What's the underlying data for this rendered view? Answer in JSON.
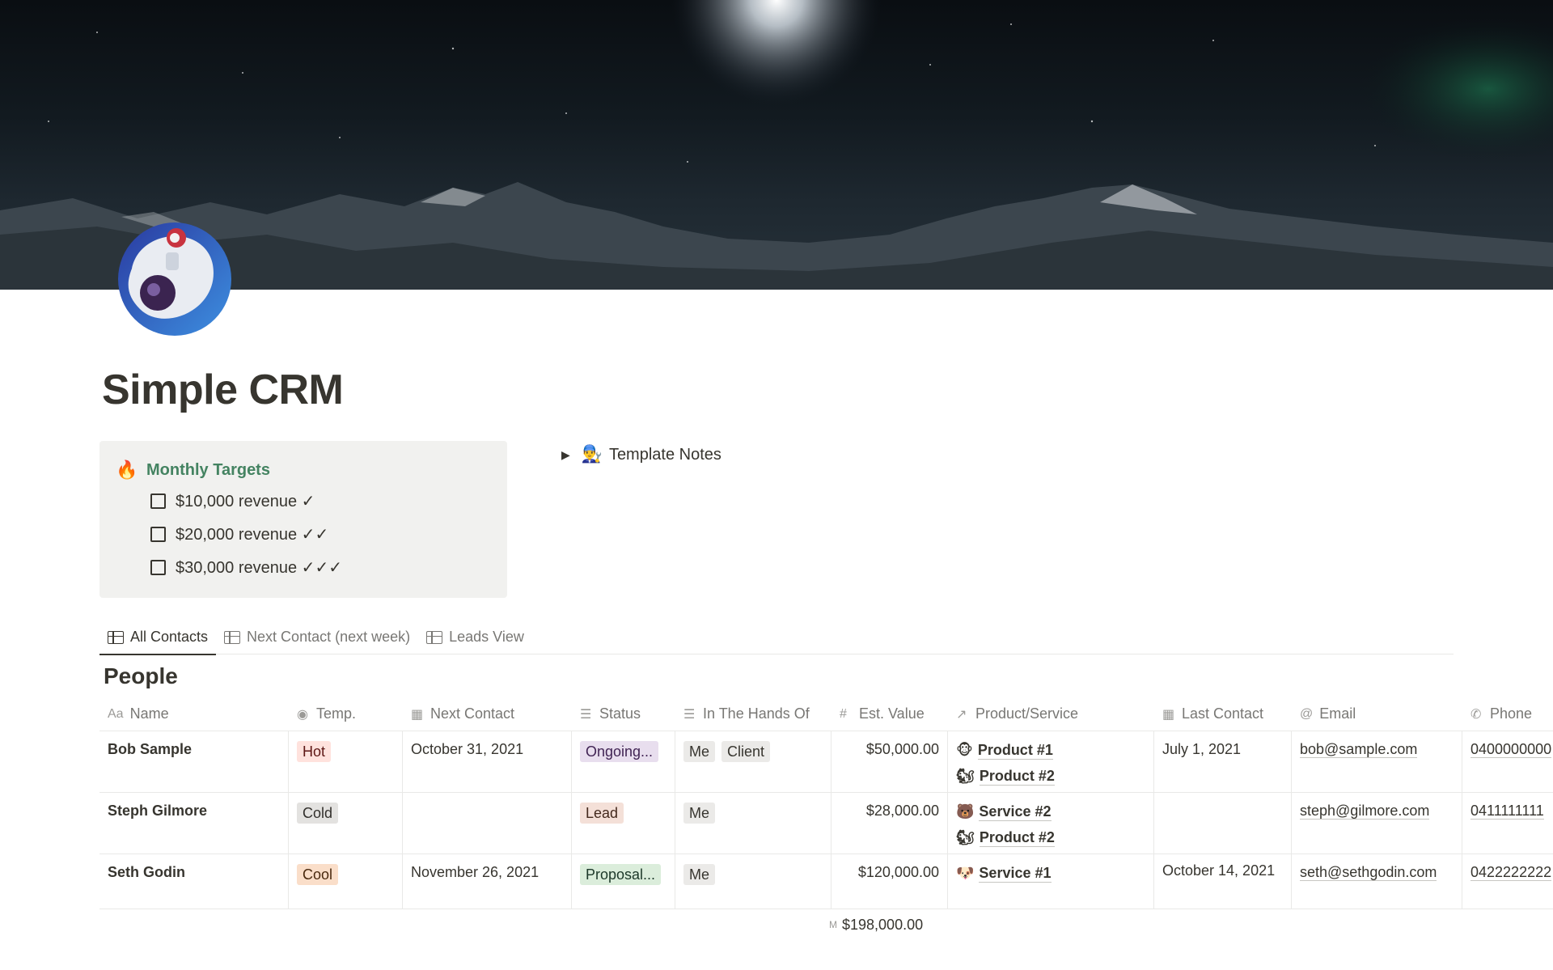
{
  "page": {
    "title": "Simple CRM"
  },
  "callout": {
    "icon": "🔥",
    "title": "Monthly Targets",
    "todos": [
      {
        "label": "$10,000 revenue ✓",
        "checked": false
      },
      {
        "label": "$20,000 revenue ✓✓",
        "checked": false
      },
      {
        "label": "$30,000 revenue ✓✓✓",
        "checked": false
      }
    ]
  },
  "toggle": {
    "icon": "👨‍🔧",
    "label": "Template Notes"
  },
  "tabs": [
    {
      "label": "All Contacts",
      "active": true
    },
    {
      "label": "Next Contact (next week)",
      "active": false
    },
    {
      "label": "Leads View",
      "active": false
    }
  ],
  "database": {
    "title": "People",
    "columns": [
      {
        "icon": "Aa",
        "label": "Name"
      },
      {
        "icon": "◉",
        "label": "Temp."
      },
      {
        "icon": "▦",
        "label": "Next Contact"
      },
      {
        "icon": "☰",
        "label": "Status"
      },
      {
        "icon": "☰",
        "label": "In The Hands Of"
      },
      {
        "icon": "#",
        "label": "Est. Value"
      },
      {
        "icon": "↗",
        "label": "Product/Service"
      },
      {
        "icon": "▦",
        "label": "Last Contact"
      },
      {
        "icon": "@",
        "label": "Email"
      },
      {
        "icon": "✆",
        "label": "Phone"
      }
    ],
    "rows": [
      {
        "name": "Bob Sample",
        "temp": "Hot",
        "next_contact": "October 31, 2021",
        "status": "Ongoing...",
        "hands": [
          "Me",
          "Client"
        ],
        "value": "$50,000.00",
        "products": [
          {
            "emoji": "🐵",
            "label": "Product #1"
          },
          {
            "emoji": "🐿",
            "label": "Product #2"
          }
        ],
        "last_contact": "July 1, 2021",
        "email": "bob@sample.com",
        "phone": "0400000000"
      },
      {
        "name": "Steph Gilmore",
        "temp": "Cold",
        "next_contact": "",
        "status": "Lead",
        "hands": [
          "Me"
        ],
        "value": "$28,000.00",
        "products": [
          {
            "emoji": "🐻",
            "label": "Service #2"
          },
          {
            "emoji": "🐿",
            "label": "Product #2"
          }
        ],
        "last_contact": "",
        "email": "steph@gilmore.com",
        "phone": "0411111111"
      },
      {
        "name": "Seth Godin",
        "temp": "Cool",
        "next_contact": "November 26, 2021",
        "status": "Proposal...",
        "hands": [
          "Me"
        ],
        "value": "$120,000.00",
        "products": [
          {
            "emoji": "🐶",
            "label": "Service #1"
          }
        ],
        "last_contact": "October 14, 2021",
        "email": "seth@sethgodin.com",
        "phone": "0422222222"
      }
    ],
    "summary": {
      "label": "M",
      "value": "$198,000.00"
    }
  },
  "colors": {
    "tag_hot": "#ffe2dd",
    "tag_cold": "#e3e2e0",
    "tag_cool": "#fadec9",
    "status_ongoing": "#e8deee",
    "status_lead": "#f4e0d8",
    "status_proposal": "#dbeddb",
    "person_tag": "#ebeae8",
    "accent_green": "#448361"
  }
}
